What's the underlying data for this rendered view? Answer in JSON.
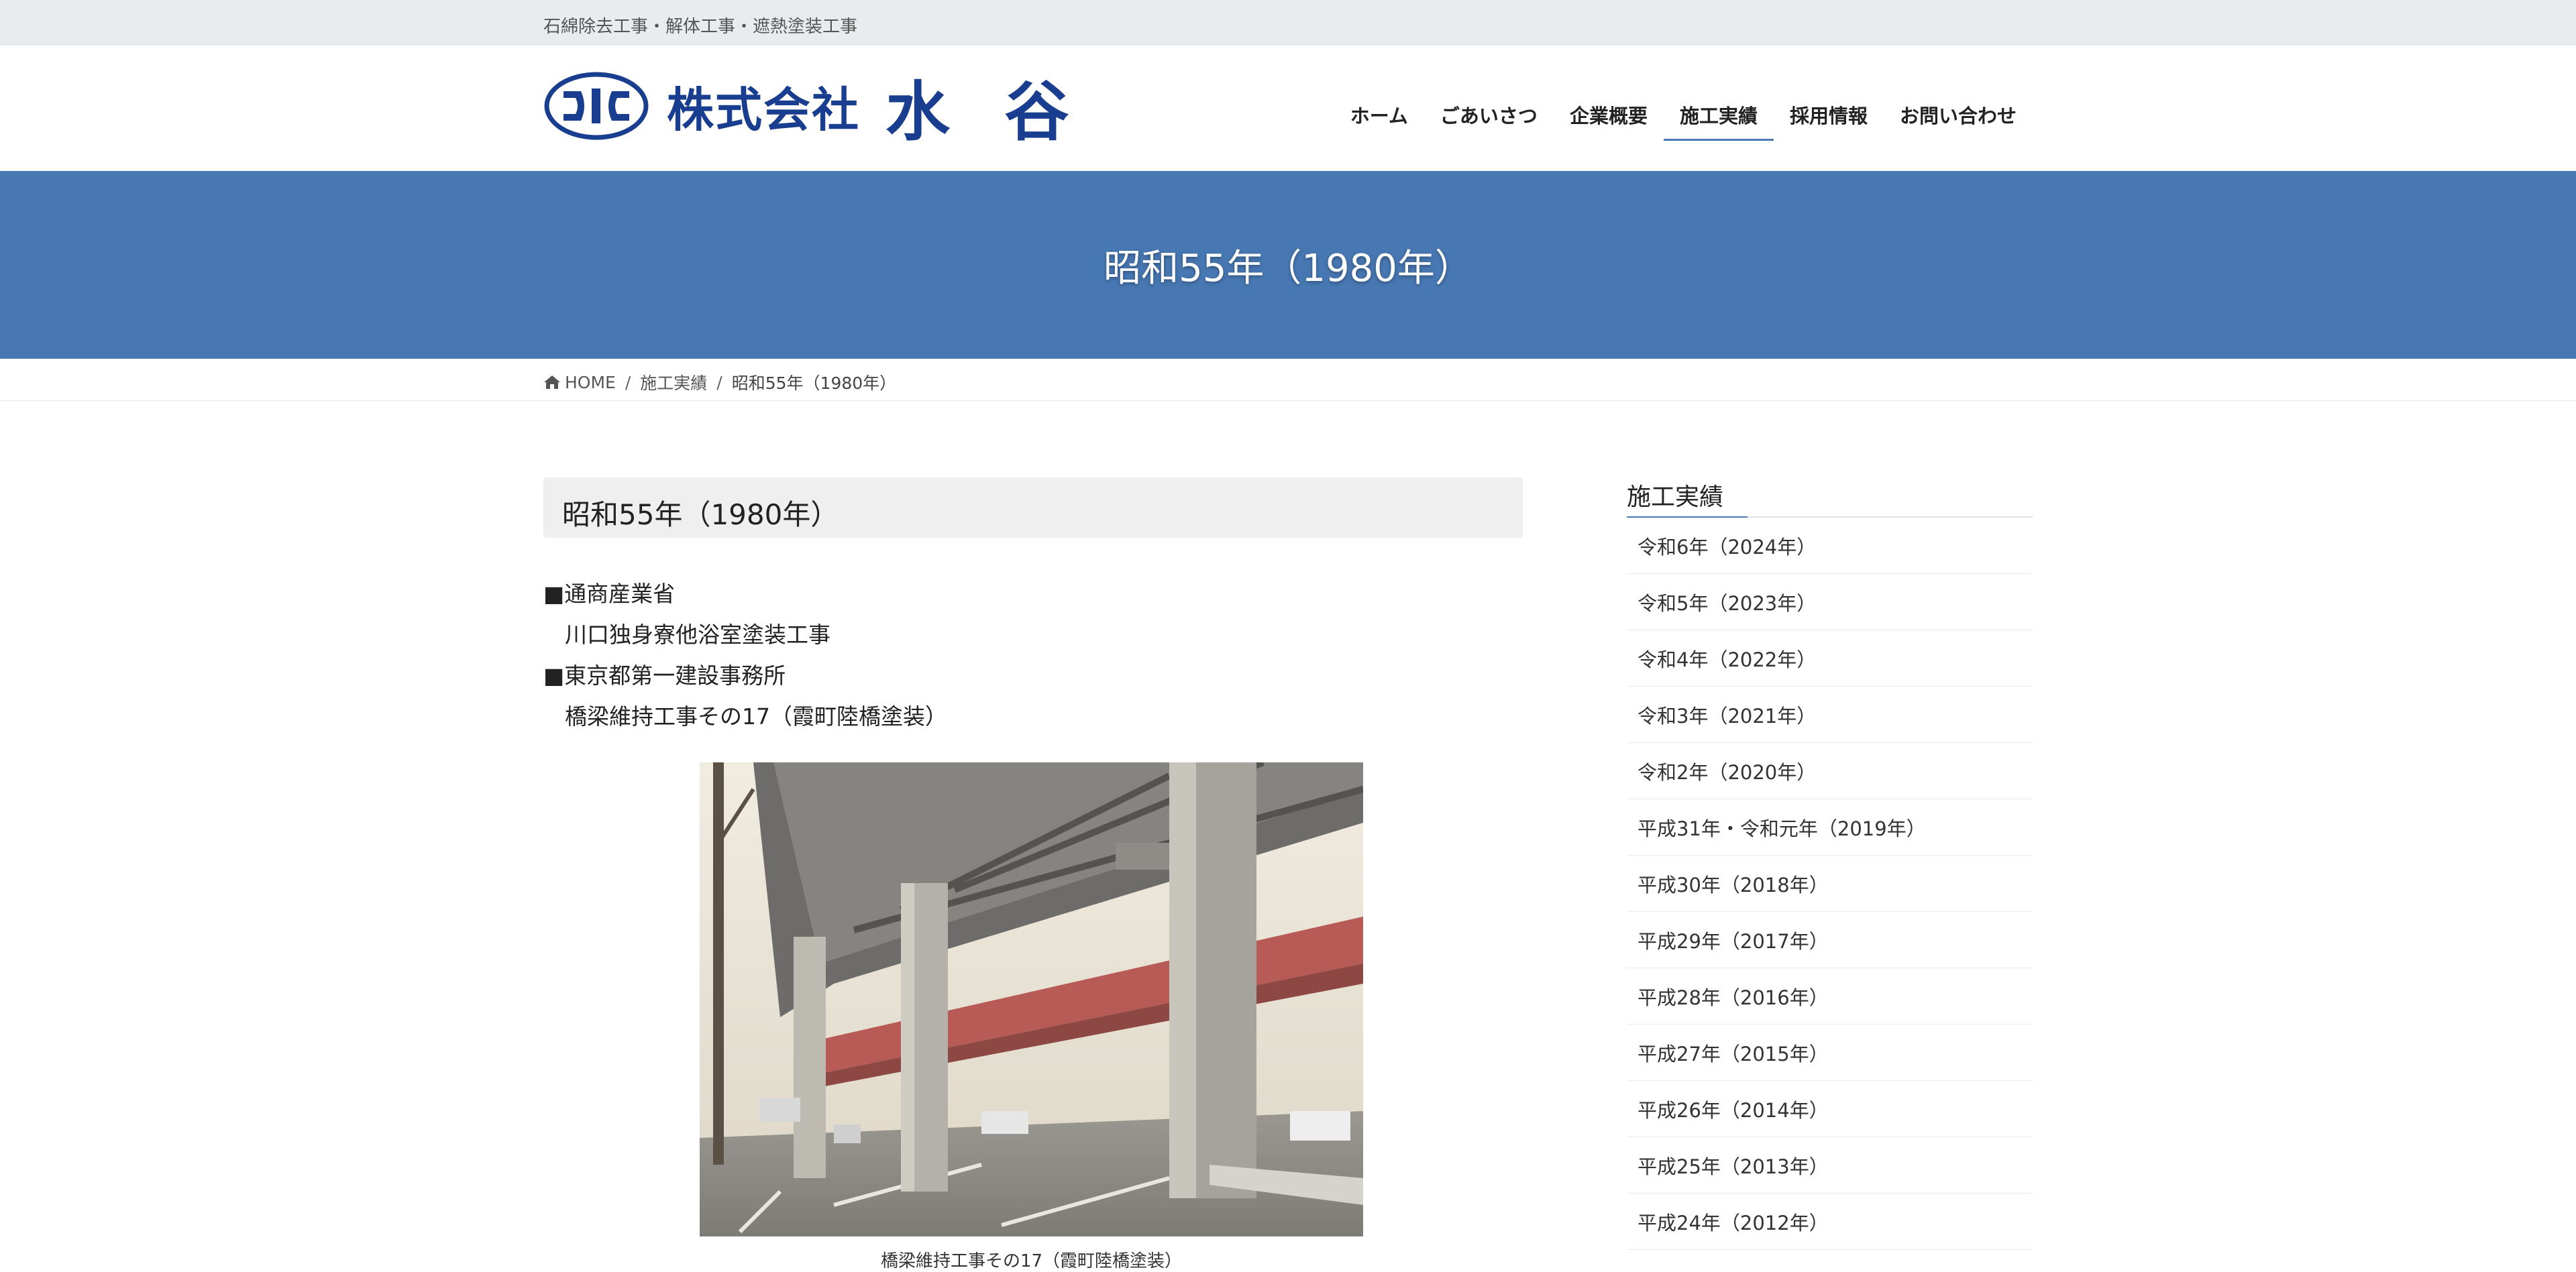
{
  "topbar": {
    "tagline": "石綿除去工事・解体工事・遮熱塗装工事"
  },
  "header": {
    "logo_company": "株式会社",
    "logo_name": "水 谷",
    "brand_color": "#1a3e8f"
  },
  "nav": {
    "items": [
      {
        "label": "ホーム"
      },
      {
        "label": "ごあいさつ"
      },
      {
        "label": "企業概要"
      },
      {
        "label": "施工実績",
        "active": true
      },
      {
        "label": "採用情報"
      },
      {
        "label": "お問い合わせ"
      }
    ],
    "accent_color": "#4a7ab5"
  },
  "banner": {
    "title": "昭和55年（1980年）",
    "background_color": "#4878b3"
  },
  "breadcrumb": {
    "home_icon": "home-icon",
    "home": "HOME",
    "sep1": "/",
    "category": "施工実績",
    "sep2": "/",
    "current": "昭和55年（1980年）"
  },
  "post": {
    "title": "昭和55年（1980年）",
    "entries": [
      {
        "client": "■通商産業省",
        "project": "川口独身寮他浴室塗装工事"
      },
      {
        "client": "■東京都第一建設事務所",
        "project": "橋梁維持工事その17（霞町陸橋塗装）"
      }
    ],
    "photo_caption": "橋梁維持工事その17（霞町陸橋塗装）"
  },
  "sidebar": {
    "title": "施工実績",
    "items": [
      "令和6年（2024年）",
      "令和5年（2023年）",
      "令和4年（2022年）",
      "令和3年（2021年）",
      "令和2年（2020年）",
      "平成31年・令和元年（2019年）",
      "平成30年（2018年）",
      "平成29年（2017年）",
      "平成28年（2016年）",
      "平成27年（2015年）",
      "平成26年（2014年）",
      "平成25年（2013年）",
      "平成24年（2012年）"
    ]
  }
}
